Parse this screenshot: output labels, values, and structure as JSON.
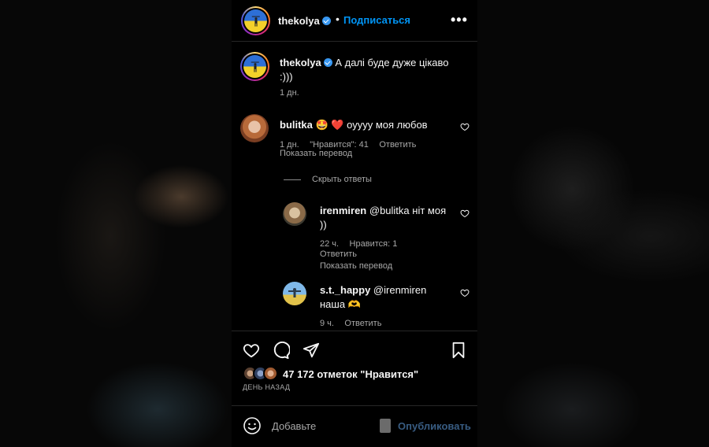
{
  "post": {
    "author": "thekolya",
    "follow_label": "Подписаться",
    "separator": "•",
    "more_label": "•••",
    "caption": "А далі буде дуже цікаво :)))",
    "caption_time": "1 дн."
  },
  "comments": [
    {
      "user": "bulitka",
      "emoji": "🤩 ❤️",
      "text": "оуууу моя любов",
      "time": "1 дн.",
      "likes": "\"Нравится\": 41",
      "reply_label": "Ответить",
      "translate_label": "Показать перевод",
      "hide_replies_label": "Скрыть ответы",
      "replies": [
        {
          "user": "irenmiren",
          "text": "@bulitka ніт моя ))",
          "time": "22 ч.",
          "likes": "Нравится: 1",
          "reply_label": "Ответить",
          "translate_label": "Показать перевод"
        },
        {
          "user": "s.t._happy",
          "text": "@irenmiren наша 🫶",
          "time": "9 ч.",
          "reply_label": "Ответить"
        }
      ]
    }
  ],
  "actions": {
    "like_icon": "heart-icon",
    "comment_icon": "comment-icon",
    "share_icon": "send-icon",
    "save_icon": "bookmark-icon"
  },
  "likes_summary": "47 172 отметок \"Нравится\"",
  "posted_ago": "ДЕНЬ НАЗАД",
  "composer": {
    "placeholder": "Добавьте",
    "publish_label": "Опубликовать"
  },
  "colors": {
    "accent": "#0095f6",
    "publish_disabled": "#385c82",
    "verified": "#3897f0",
    "muted_text": "#a8a8a8"
  }
}
